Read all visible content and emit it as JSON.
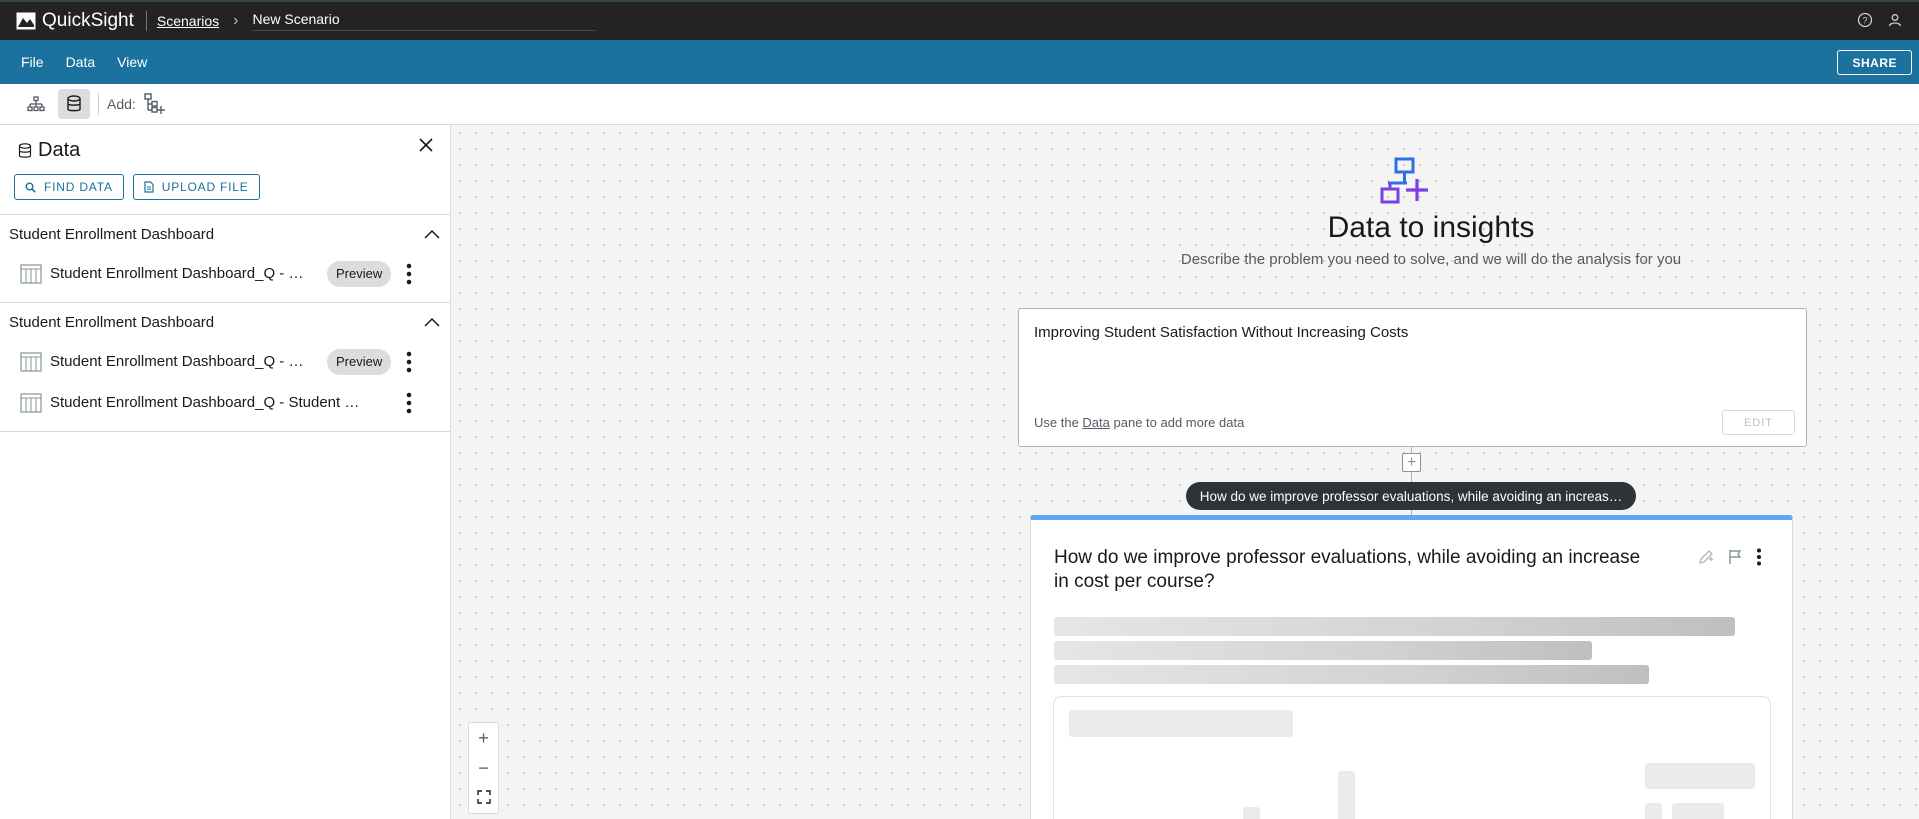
{
  "app": {
    "name": "QuickSight",
    "breadcrumb_link": "Scenarios",
    "breadcrumb_current": "New Scenario"
  },
  "menu": {
    "items": [
      "File",
      "Data",
      "View"
    ],
    "share_label": "SHARE"
  },
  "toolbar": {
    "add_label": "Add:"
  },
  "data_panel": {
    "title": "Data",
    "find_data_label": "FIND DATA",
    "upload_file_label": "UPLOAD FILE",
    "groups": [
      {
        "name": "Student Enrollment Dashboard",
        "datasets": [
          {
            "name": "Student Enrollment Dashboard_Q - …",
            "preview_label": "Preview"
          }
        ]
      },
      {
        "name": "Student Enrollment Dashboard",
        "datasets": [
          {
            "name": "Student Enrollment Dashboard_Q - …",
            "preview_label": "Preview"
          },
          {
            "name": "Student Enrollment Dashboard_Q - Student …",
            "preview_label": ""
          }
        ]
      }
    ]
  },
  "canvas": {
    "hero_title": "Data to insights",
    "hero_subtitle": "Describe the problem you need to solve, and we will do the analysis for you",
    "problem_text": "Improving Student Satisfaction Without Increasing Costs",
    "hint_prefix": "Use the ",
    "hint_link": "Data",
    "hint_suffix": " pane to add more data",
    "edit_label": "EDIT",
    "question_pill": "How do we improve professor evaluations, while avoiding an increas…",
    "analysis_title": "How do we improve professor evaluations, while avoiding an increase in cost per course?"
  },
  "colors": {
    "menubar": "#1c729e",
    "topbar": "#232323",
    "accent_gradient": "#5fa6f4",
    "hero_icon_blue": "#2f6fe4",
    "hero_icon_purple": "#7b3fe4"
  }
}
